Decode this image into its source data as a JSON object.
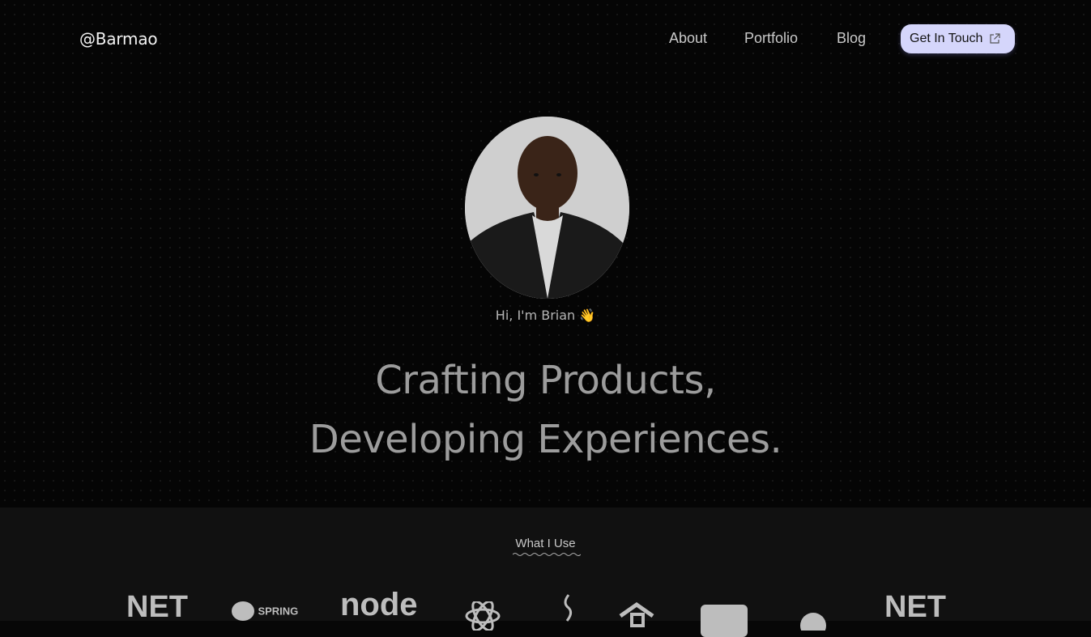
{
  "header": {
    "logo": "@Barmao",
    "nav": [
      "About",
      "Portfolio",
      "Blog"
    ],
    "cta_label": "Get In Touch",
    "cta_icon": "external-link-icon"
  },
  "hero": {
    "greeting": "Hi, I'm Brian 👋",
    "headline_line1": "Crafting Products,",
    "headline_line2": "Developing Experiences."
  },
  "section": {
    "title": "What I Use",
    "tech_partial": [
      "NET",
      "SPRING",
      "node",
      "react-icon",
      "java-icon",
      "cube-icon",
      "box-icon",
      "swift-icon",
      "NET"
    ]
  },
  "colors": {
    "background": "#050505",
    "cta_bg": "#d5d6fb",
    "headline": "#9c9c9c",
    "section_bg": "#111111"
  }
}
